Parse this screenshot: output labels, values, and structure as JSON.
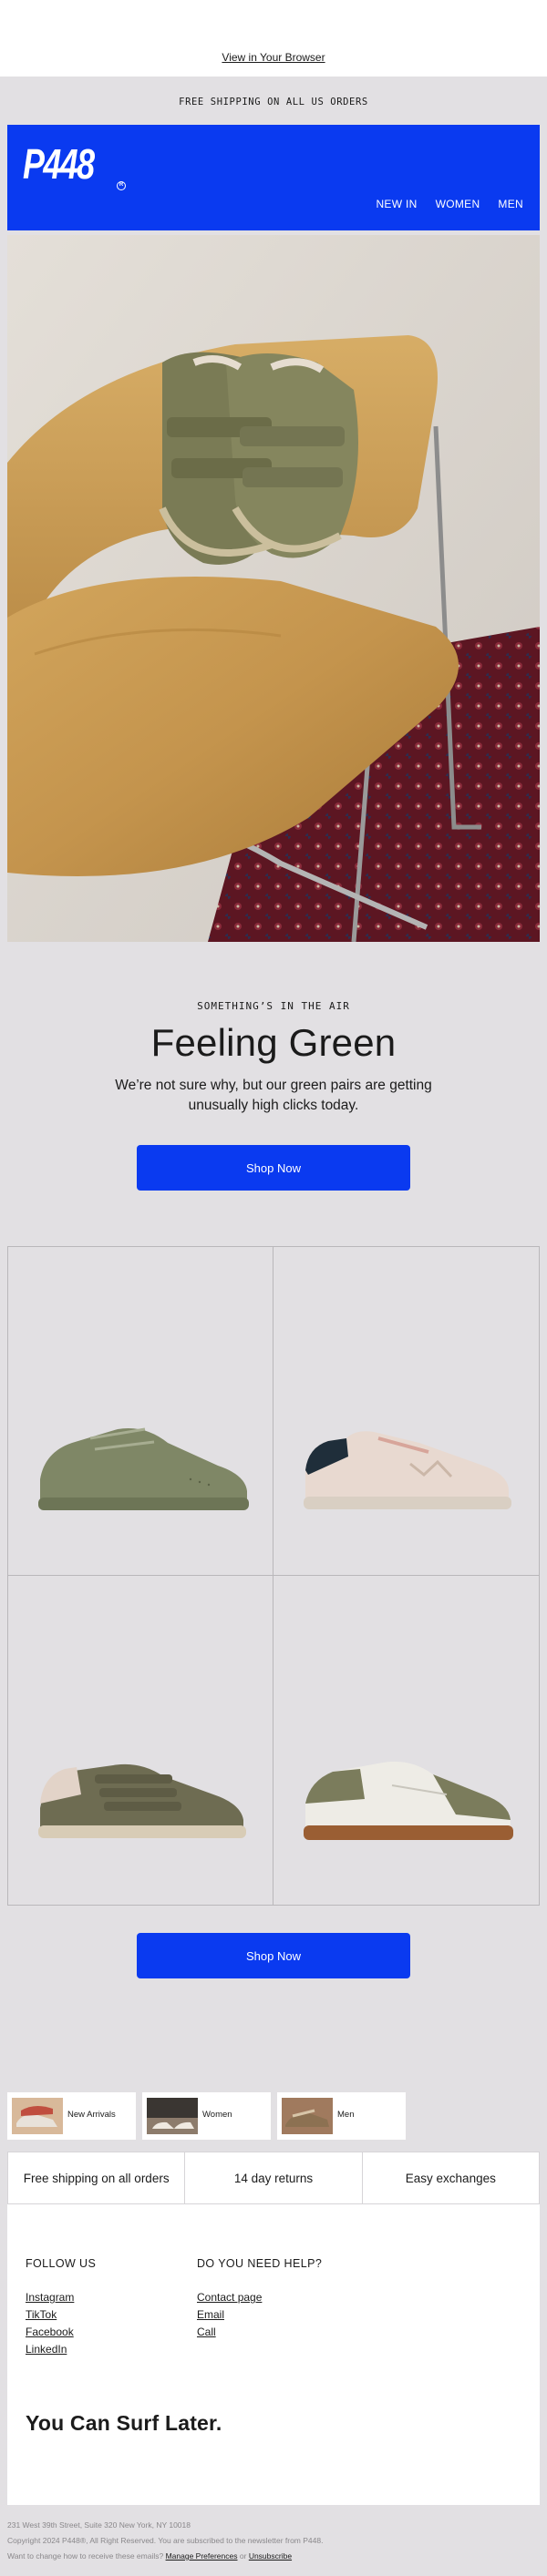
{
  "preheader": {
    "view_in_browser": "View in Your Browser"
  },
  "shipping_banner": "FREE SHIPPING ON ALL US ORDERS",
  "header": {
    "logo": "P448",
    "logo_mark": "R",
    "nav": [
      "NEW IN",
      "WOMEN",
      "MEN"
    ]
  },
  "hero_section": {
    "eyebrow": "SOMETHING’S IN THE AIR",
    "headline": "Feeling Green",
    "subcopy": "We’re not sure why, but our green pairs are getting unusually high clicks today.",
    "cta": "Shop Now"
  },
  "products": {
    "cta": "Shop Now"
  },
  "categories": [
    {
      "label": "New Arrivals"
    },
    {
      "label": "Women"
    },
    {
      "label": "Men"
    }
  ],
  "benefits": [
    "Free shipping on all orders",
    "14 day returns",
    "Easy exchanges"
  ],
  "footer": {
    "follow_title": "FOLLOW US",
    "social_links": [
      "Instagram",
      "TikTok",
      "Facebook",
      "LinkedIn"
    ],
    "help_title": "DO YOU NEED HELP?",
    "help_links": [
      "Contact page",
      "Email",
      "Call"
    ],
    "tagline": "You Can Surf Later.",
    "address": "231 West 39th Street, Suite 320 New York, NY 10018",
    "copyright": "Copyright 2024 P448®, All Right Reserved. You are subscribed to the newsletter from P448.",
    "prefs_prefix": "Want to change how to receive these emails?",
    "manage_prefs": "Manage Preferences",
    "or": "or",
    "unsubscribe": "Unsubscribe"
  },
  "colors": {
    "brand_blue": "#0a3af0",
    "background": "#e2e0e3"
  }
}
